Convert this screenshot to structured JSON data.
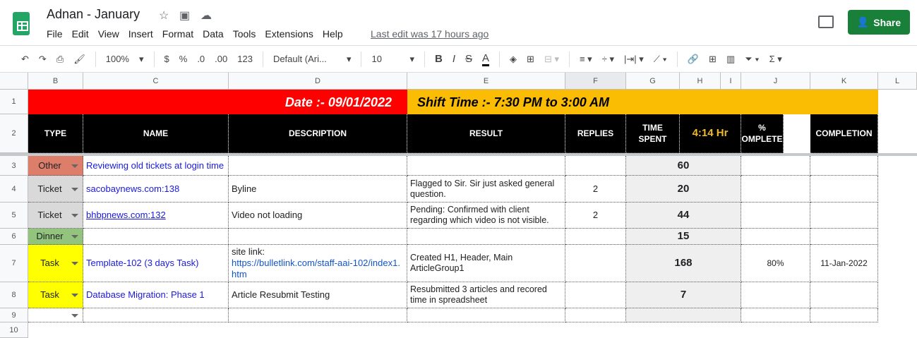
{
  "app": {
    "title": "Adnan - January",
    "menu": [
      "File",
      "Edit",
      "View",
      "Insert",
      "Format",
      "Data",
      "Tools",
      "Extensions",
      "Help"
    ],
    "last_edit": "Last edit was 17 hours ago",
    "share": "Share"
  },
  "toolbar": {
    "zoom": "100%",
    "currency": "$",
    "percent": "%",
    "dec_dec": ".0",
    "dec_inc": ".00",
    "format": "123",
    "font": "Default (Ari...",
    "size": "10",
    "bold": "B",
    "italic": "I",
    "strike": "S",
    "textcolor": "A"
  },
  "columns": [
    "B",
    "C",
    "D",
    "E",
    "F",
    "G",
    "H",
    "I",
    "J",
    "K",
    "L"
  ],
  "rows": [
    "1",
    "2",
    "3",
    "4",
    "5",
    "6",
    "7",
    "8",
    "9",
    "10"
  ],
  "sheet": {
    "date": "Date :- 09/01/2022",
    "shift": "Shift Time :- 7:30 PM to 3:00 AM",
    "headers": {
      "type": "TYPE",
      "name": "NAME",
      "description": "DESCRIPTION",
      "result": "RESULT",
      "replies": "REPLIES",
      "time_spent": "TIME SPENT",
      "total": "4:14  Hr",
      "pct": "% COMPLETED",
      "completion": "COMPLETION"
    },
    "colors": {
      "red": "#ff0000",
      "amber": "#fbbc04",
      "Other": "#dd7e6b",
      "Ticket": "#d9d9d9",
      "Dinner": "#93c47d",
      "Task": "#ffff00"
    },
    "data": [
      {
        "type": "Other",
        "name": "Reviewing old tickets at login time",
        "description": "",
        "link": "",
        "result": "",
        "replies": "",
        "time": "60",
        "pct": "",
        "completion": ""
      },
      {
        "type": "Ticket",
        "name": "sacobaynews.com:138",
        "description": "Byline",
        "link": "",
        "result": "Flagged to Sir. Sir just asked general question.",
        "replies": "2",
        "time": "20",
        "pct": "",
        "completion": ""
      },
      {
        "type": "Ticket",
        "name": "bhbpnews.com:132",
        "name_link": true,
        "description": "Video not loading",
        "link": "",
        "result": "Pending: Confirmed with client regarding which video is not visible.",
        "replies": "2",
        "time": "44",
        "pct": "",
        "completion": ""
      },
      {
        "type": "Dinner",
        "name": "",
        "description": "",
        "link": "",
        "result": "",
        "replies": "",
        "time": "15",
        "pct": "",
        "completion": ""
      },
      {
        "type": "Task",
        "name": "Template-102 (3 days Task)",
        "description": "site link:",
        "link": "https://bulletlink.com/staff-aai-102/index1.htm",
        "result": "Created H1, Header, Main ArticleGroup1",
        "replies": "",
        "time": "168",
        "pct": "80%",
        "completion": "11-Jan-2022"
      },
      {
        "type": "Task",
        "name": "Database Migration: Phase 1",
        "description": "Article Resubmit Testing",
        "link": "",
        "result": "Resubmitted 3 articles and recored time in spreadsheet",
        "replies": "",
        "time": "7",
        "pct": "",
        "completion": ""
      },
      {
        "type": "",
        "name": "",
        "description": "",
        "link": "",
        "result": "",
        "replies": "",
        "time": "",
        "pct": "",
        "completion": ""
      }
    ]
  }
}
